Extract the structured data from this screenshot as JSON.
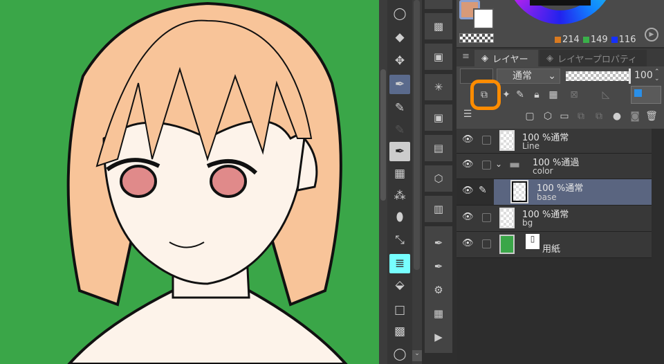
{
  "color": {
    "r": 214,
    "g": 149,
    "b": 116,
    "main_color": "#d89a78",
    "sub_color": "#ffffff"
  },
  "tabs": {
    "layer": "レイヤー",
    "layer_property": "レイヤープロパティ"
  },
  "toolbar": {
    "blend_mode": "通常",
    "opacity": "100",
    "opacity_fraction": 1.0
  },
  "layers": [
    {
      "mode": "100 %通常",
      "name": "Line"
    },
    {
      "mode": "100 %通過",
      "name": "color",
      "type": "folder"
    },
    {
      "mode": "100 %通常",
      "name": "base",
      "selected": true
    },
    {
      "mode": "100 %通常",
      "name": "bg"
    },
    {
      "name": "用紙",
      "type": "paper",
      "color": "#3aa648"
    }
  ],
  "highlight_color": "#ff8c00"
}
